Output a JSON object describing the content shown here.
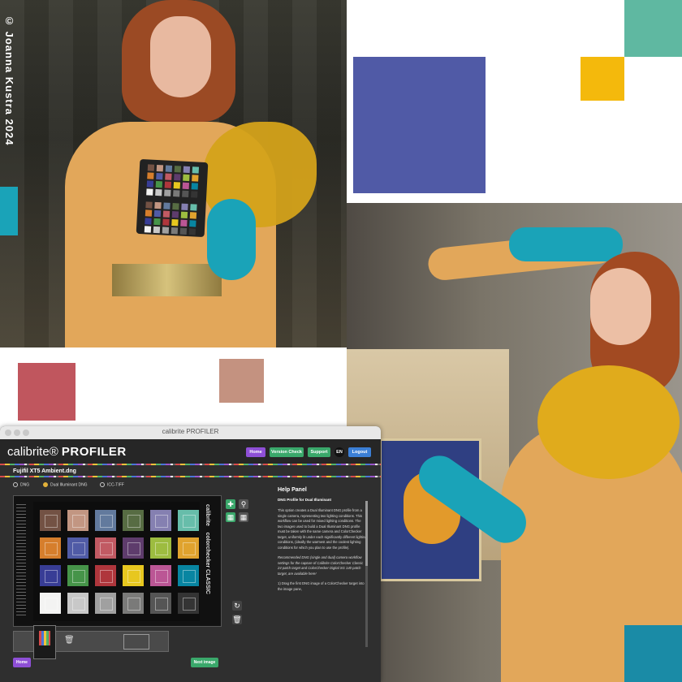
{
  "credit": "© Joanna Kustra 2024",
  "colors": {
    "blue_block": "#505aa6",
    "teal_block": "#5fb8a1",
    "yellow_block": "#f4b90c",
    "rose_swatch": "#c0565e",
    "skin_swatch": "#c49280",
    "teal_corner": "#1a8ba6"
  },
  "app": {
    "window_title": "calibrite PROFILER",
    "logo_text": "calibrite",
    "logo_bold": "PROFILER",
    "header_buttons": [
      {
        "label": "Home",
        "color": "#8e4fd6"
      },
      {
        "label": "Version Check",
        "color": "#3aa86b"
      },
      {
        "label": "Support",
        "color": "#3aa86b"
      },
      {
        "label": "EN",
        "color": "#111111"
      },
      {
        "label": "Logout",
        "color": "#3b7fd6"
      }
    ],
    "file_name": "Fujifil XT5 Ambient.dng",
    "radio_options": [
      "DNG",
      "Dual Illuminant DNG",
      "ICC-TIFF"
    ],
    "target_label": "colorchecker CLASSIC",
    "target_brand": "calibrite",
    "footer_buttons": {
      "home": "Home",
      "next": "Next image"
    },
    "help": {
      "title": "Help Panel",
      "subtitle": "DNG Profile for Dual Illuminant",
      "p1": "This option creates a Dual Illuminant DNG profile from a single camera, representing two lighting conditions. This workflow can be used for mixed lighting conditions. The two images used to build a Dual Illuminant DNG profile must be taken with the same camera and ColorChecker target, uniformly lit under each significantly different lighting conditions, (ideally the warmest and the coolest lighting conditions for which you plan to use the profile).",
      "p2": "Recommended DNG (single and dual) camera workflow settings for the capture of Calibrite ColorChecker Classic 24 patch target and ColorChecker Digital SG 140 patch target, are available here!",
      "p3": "1) Drag the first DNG image of a ColorChecker target into the image pane,"
    }
  }
}
